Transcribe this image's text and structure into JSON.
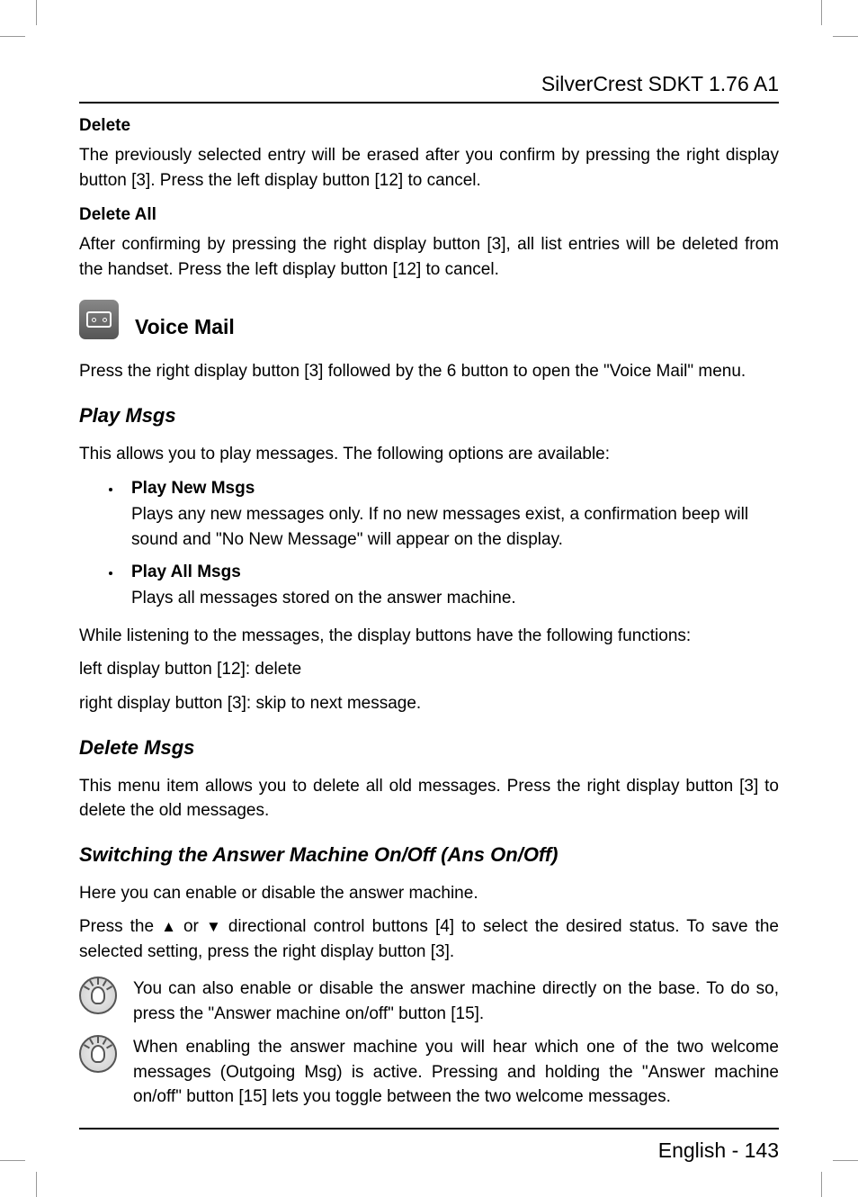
{
  "header": {
    "title": "SilverCrest SDKT 1.76 A1"
  },
  "delete": {
    "heading": "Delete",
    "body": "The previously selected entry will be erased after you confirm by pressing the right display button [3]. Press the left display button [12] to cancel."
  },
  "delete_all": {
    "heading": "Delete All",
    "body": "After confirming by pressing the right display button [3], all list entries will be deleted from the handset. Press the left display button [12] to cancel."
  },
  "voicemail": {
    "title": "Voice Mail",
    "intro": "Press the right display button [3] followed by the 6 button to open the \"Voice Mail\" menu."
  },
  "play_msgs": {
    "heading": "Play Msgs",
    "intro": "This allows you to play messages. The following options are available:",
    "bullets": [
      {
        "title": "Play New Msgs",
        "body": "Plays any new messages only. If no new messages exist, a confirmation beep will sound and \"No New Message\" will appear on the display."
      },
      {
        "title": "Play All Msgs",
        "body": "Plays all messages stored on the answer machine."
      }
    ],
    "while_listening": "While listening to the messages, the display buttons have the following functions:",
    "left_btn": "left display button [12]: delete",
    "right_btn": "right display button [3]: skip to next message."
  },
  "delete_msgs": {
    "heading": "Delete Msgs",
    "body": "This menu item allows you to delete all old messages. Press the right display button [3] to delete the old messages."
  },
  "ans_onoff": {
    "heading": "Switching the Answer Machine On/Off (Ans On/Off)",
    "intro": "Here you can enable or disable the answer machine.",
    "press_prefix": "Press the ",
    "press_mid": " or ",
    "press_suffix": " directional control buttons [4] to select the desired status. To save the selected setting, press the right display button [3].",
    "tip1": "You can also enable or disable the answer machine directly on the base. To do so, press the \"Answer machine on/off\" button [15].",
    "tip2": "When enabling the answer machine you will hear which one of the two welcome messages (Outgoing Msg) is active. Pressing and holding the \"Answer machine on/off\" button [15] lets you toggle between the two welcome messages."
  },
  "footer": {
    "text": "English  -  143"
  }
}
